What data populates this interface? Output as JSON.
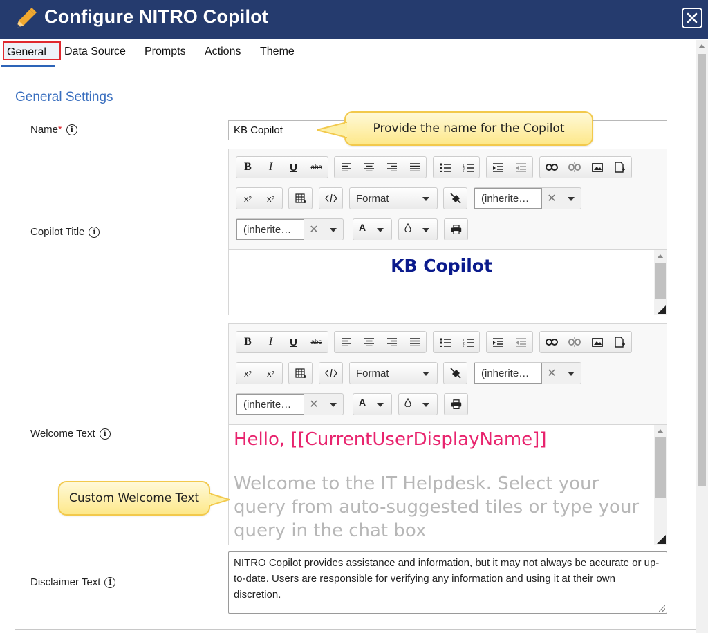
{
  "header": {
    "title": "Configure NITRO Copilot"
  },
  "tabs": [
    {
      "label": "General"
    },
    {
      "label": "Data Source"
    },
    {
      "label": "Prompts"
    },
    {
      "label": "Actions"
    },
    {
      "label": "Theme"
    }
  ],
  "section_title": "General Settings",
  "fields": {
    "name": {
      "label": "Name",
      "required_marker": "*",
      "value": "KB Copilot"
    },
    "copilot_title": {
      "label": "Copilot Title",
      "content": "KB Copilot"
    },
    "welcome_text": {
      "label": "Welcome Text",
      "hello": "Hello, [[CurrentUserDisplayName]]",
      "body": "Welcome to the IT Helpdesk. Select your query from auto-suggested tiles or type your query in the chat box"
    },
    "disclaimer_text": {
      "label": "Disclaimer Text",
      "value": "NITRO Copilot provides assistance and information, but it may not always be accurate or up-to-date. Users are responsible for verifying any information and using it at their own discretion."
    }
  },
  "toolbar": {
    "bold": "B",
    "italic": "I",
    "underline": "U",
    "strike": "abc",
    "format_label": "Format",
    "font_value": "(inherite…",
    "size_value": "(inherite…",
    "text_color_label": "A"
  },
  "callouts": {
    "name_hint": "Provide the name for the Copilot",
    "welcome_hint": "Custom Welcome Text"
  },
  "colors": {
    "header_bg": "#253b6e",
    "accent": "#3a6fbf",
    "title_text": "#0a1a8c",
    "hello_text": "#e8246e",
    "placeholder_text": "#b7b7b7",
    "active_tab_border": "#e0282e"
  }
}
